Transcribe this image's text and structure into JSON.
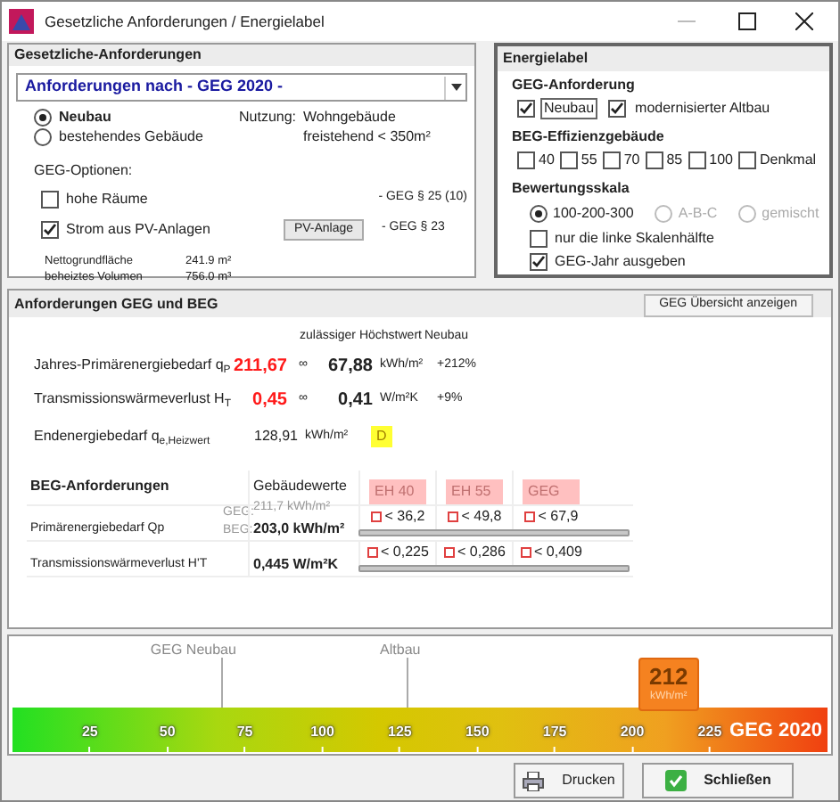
{
  "window": {
    "title": "Gesetzliche Anforderungen  /  Energielabel"
  },
  "requirements": {
    "heading": "Gesetzliche-Anforderungen",
    "dropdown": "Anforderungen nach  - GEG 2020 -",
    "building_types": [
      {
        "label": "Neubau",
        "selected": true
      },
      {
        "label": "bestehendes Gebäude",
        "selected": false
      }
    ],
    "usage_label": "Nutzung:",
    "usage_value": [
      "Wohngebäude",
      "freistehend < 350m²"
    ],
    "options_heading": "GEG-Optionen:",
    "options": [
      {
        "label": "hohe Räume",
        "checked": false,
        "reference": "- GEG § 25 (10)"
      },
      {
        "label": "Strom aus PV-Anlagen",
        "checked": true,
        "button": "PV-Anlage",
        "reference": "- GEG § 23"
      }
    ],
    "areas": [
      {
        "label": "Nettogrundfläche",
        "value": "241.9 m²"
      },
      {
        "label": "beheiztes Volumen",
        "value": "756.0 m³"
      }
    ]
  },
  "energy_label": {
    "heading": "Energielabel",
    "geg_heading": "GEG-Anforderung",
    "geg_checks": [
      {
        "label": "Neubau",
        "checked": true,
        "focused": true
      },
      {
        "label": "modernisierter Altbau",
        "checked": true,
        "focused": false
      }
    ],
    "beg_heading": "BEG-Effizienzgebäude",
    "beg_checks": [
      {
        "label": "40",
        "checked": false
      },
      {
        "label": "55",
        "checked": false
      },
      {
        "label": "70",
        "checked": false
      },
      {
        "label": "85",
        "checked": false
      },
      {
        "label": "100",
        "checked": false
      },
      {
        "label": "Denkmal",
        "checked": false
      }
    ],
    "scale_heading": "Bewertungsskala",
    "scale_radios": [
      {
        "label": "100-200-300",
        "selected": true,
        "disabled": false
      },
      {
        "label": "A-B-C",
        "selected": false,
        "disabled": true
      },
      {
        "label": "gemischt",
        "selected": false,
        "disabled": true
      }
    ],
    "scale_checks": [
      {
        "label": "nur die linke Skalenhälfte",
        "checked": false
      },
      {
        "label": "GEG-Jahr ausgeben",
        "checked": true
      }
    ]
  },
  "geg_beg": {
    "heading": "Anforderungen GEG und BEG",
    "button": "GEG Übersicht anzeigen",
    "col_limit": "zulässiger Höchstwert",
    "col_new": "Neubau",
    "rows": [
      {
        "label": "Jahres-Primärenergiebedarf q$_{P}$",
        "value": "211,67",
        "op": "∞",
        "limit": "67,88",
        "unit": "kWh/m²",
        "percent": "+212%"
      },
      {
        "label": "Transmissionswärmeverlust H$_{T}$",
        "value": "0,45",
        "op": "∞",
        "limit": "0,41",
        "unit": "W/m²K",
        "percent": "+9%"
      }
    ],
    "final": {
      "label": "Endenergiebedarf q$_{e,Heizwert}$",
      "value": "128,91",
      "unit": "kWh/m²",
      "badge": "D"
    },
    "beg": {
      "heading": "BEG-Anforderungen",
      "col_values": "Gebäudewerte",
      "classes": [
        "EH 40",
        "EH 55",
        "GEG"
      ],
      "primary": {
        "label": "Primärenergiebedarf Qp",
        "geg_tag": "GEG:",
        "geg_value": "211,7 kWh/m²",
        "beg_tag": "BEG:",
        "beg_value": "203,0 kWh/m²",
        "limits": [
          {
            "text": "< 36,2",
            "checked": false
          },
          {
            "text": "< 49,8",
            "checked": false
          },
          {
            "text": "< 67,9",
            "checked": false
          }
        ],
        "level": 0
      },
      "transmission": {
        "label": "Transmissionswärmeverlust H'T",
        "value": "0,445 W/m²K",
        "limits": [
          {
            "text": "< 0,225",
            "checked": false
          },
          {
            "text": "< 0,286",
            "checked": false
          },
          {
            "text": "< 0,409",
            "checked": false
          }
        ],
        "level": 0
      }
    }
  },
  "scale": {
    "markers": [
      {
        "label": "GEG  Neubau",
        "level": 0.257
      },
      {
        "label": "Altbau",
        "level": 0.483
      }
    ],
    "ticks": [
      "25",
      "50",
      "75",
      "100",
      "125",
      "150",
      "175",
      "200",
      "225"
    ],
    "indicator": {
      "value": "212",
      "unit": "kWh/m²",
      "level": 0.805
    },
    "label": "GEG 2020"
  },
  "buttons": [
    {
      "label": "Drucken",
      "kind": "print"
    },
    {
      "label": "Schließen",
      "kind": "close"
    }
  ]
}
